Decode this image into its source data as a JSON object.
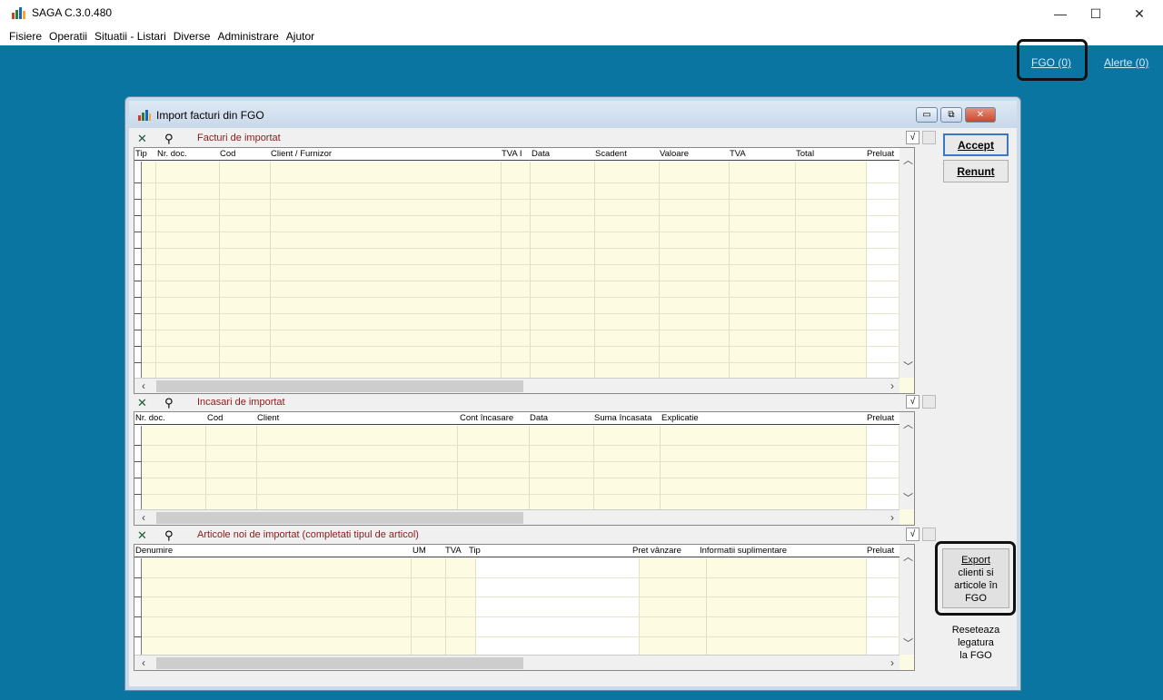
{
  "app": {
    "title": "SAGA C.3.0.480"
  },
  "window_controls": {
    "minimize": "—",
    "maximize": "☐",
    "close": "✕"
  },
  "menu": [
    "Fisiere",
    "Operatii",
    "Situatii - Listari",
    "Diverse",
    "Administrare",
    "Ajutor"
  ],
  "links": {
    "fgo": "FGO (0)",
    "alerte": "Alerte (0)"
  },
  "dialog": {
    "title": "Import facturi din FGO",
    "controls": {
      "minimize": "▭",
      "restore": "⧉",
      "close": "✕"
    },
    "check_glyph": "√",
    "accept": "Accept",
    "renunt": "Renunt",
    "export_lines": [
      "Export",
      "clienti si",
      "articole în",
      "FGO"
    ],
    "reset_lines": [
      "Reseteaza",
      "legatura",
      "la FGO"
    ]
  },
  "facturi": {
    "title": "Facturi de importat",
    "columns": [
      "Tip",
      "Nr. doc.",
      "Cod",
      "Client / Furnizor",
      "TVA I",
      "Data",
      "Scadent",
      "Valoare",
      "TVA",
      "Total",
      "Preluat"
    ]
  },
  "incasari": {
    "title": "Incasari de importat",
    "columns": [
      "Nr. doc.",
      "Cod",
      "Client",
      "Cont încasare",
      "Data",
      "Suma încasata",
      "Explicatie",
      "Preluat"
    ]
  },
  "articole": {
    "title": "Articole noi de importat (completati tipul de articol)",
    "columns": [
      "Denumire",
      "UM",
      "TVA",
      "Tip",
      "Pret vânzare",
      "Informatii suplimentare",
      "Preluat"
    ]
  },
  "colors": {
    "desktop": "#0a75a0",
    "grid_cell": "#fdfbe1",
    "section_title": "#8b1a1a",
    "accent": "#3b78c4"
  }
}
